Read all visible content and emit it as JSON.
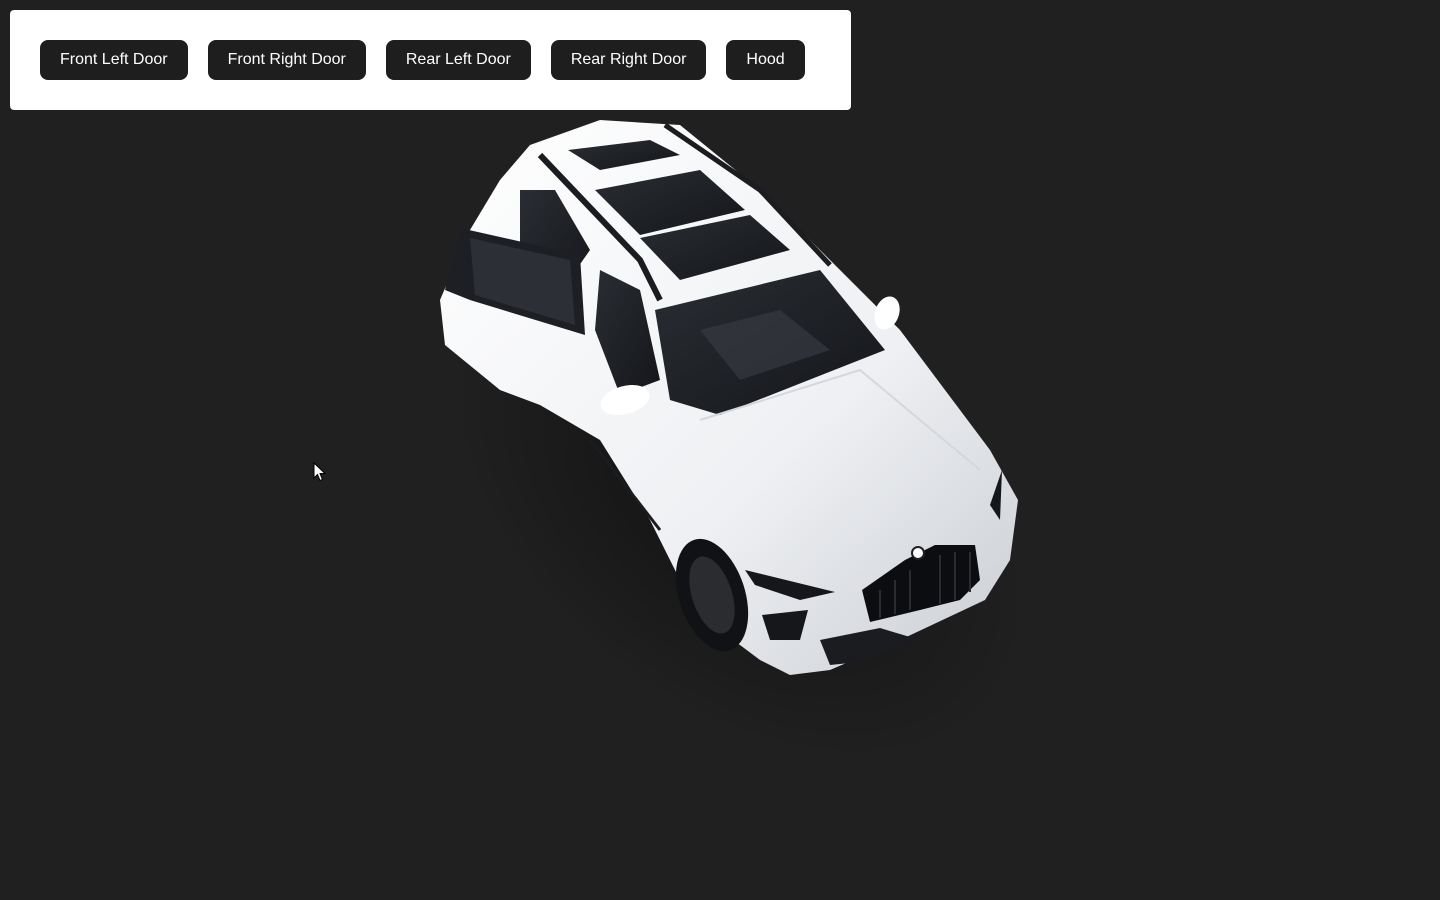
{
  "toolbar": {
    "buttons": [
      {
        "id": "front-left-door",
        "label": "Front Left Door"
      },
      {
        "id": "front-right-door",
        "label": "Front Right Door"
      },
      {
        "id": "rear-left-door",
        "label": "Rear Left Door"
      },
      {
        "id": "rear-right-door",
        "label": "Rear Right Door"
      },
      {
        "id": "hood",
        "label": "Hood"
      }
    ]
  },
  "scene": {
    "background_color": "#202020",
    "car_color": "#f2f3f5",
    "model": "white-suv-3d-model",
    "open_parts": [
      "front-left-door"
    ]
  },
  "cursor": {
    "icon": "arrow-cursor-icon"
  }
}
